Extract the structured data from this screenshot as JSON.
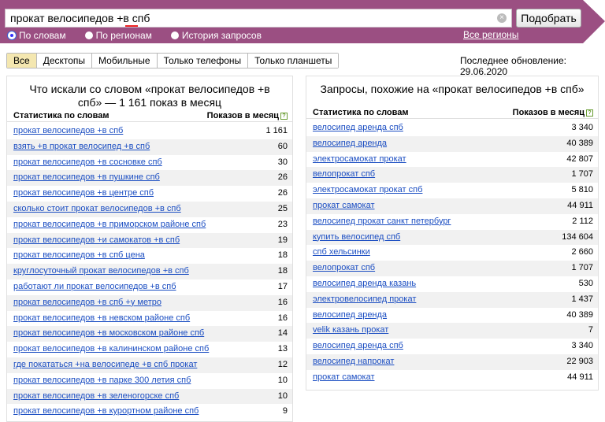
{
  "search": {
    "query": "прокат велосипедов +в спб",
    "submit_label": "Подобрать",
    "clear_glyph": "×"
  },
  "modes": [
    {
      "label": "По словам",
      "checked": true
    },
    {
      "label": "По регионам",
      "checked": false
    },
    {
      "label": "История запросов",
      "checked": false
    }
  ],
  "regions_link": "Все регионы",
  "tabs": [
    "Все",
    "Десктопы",
    "Мобильные",
    "Только телефоны",
    "Только планшеты"
  ],
  "active_tab": 0,
  "updated": "Последнее обновление: 29.06.2020",
  "colors": {
    "header": "#9b4f82",
    "link": "#1a4dc2",
    "active_tab": "#f4e7b0"
  },
  "left": {
    "title": "Что искали со словом «прокат велосипедов +в спб» — 1 161 показ в месяц",
    "col_words": "Статистика по словам",
    "col_shows": "Показов в месяц",
    "rows": [
      {
        "phrase": "прокат велосипедов +в спб",
        "count": "1 161"
      },
      {
        "phrase": "взять +в прокат велосипед +в спб",
        "count": "60"
      },
      {
        "phrase": "прокат велосипедов +в сосновке спб",
        "count": "30"
      },
      {
        "phrase": "прокат велосипедов +в пушкине спб",
        "count": "26"
      },
      {
        "phrase": "прокат велосипедов +в центре спб",
        "count": "26"
      },
      {
        "phrase": "сколько стоит прокат велосипедов +в спб",
        "count": "25"
      },
      {
        "phrase": "прокат велосипедов +в приморском районе спб",
        "count": "23"
      },
      {
        "phrase": "прокат велосипедов +и самокатов +в спб",
        "count": "19"
      },
      {
        "phrase": "прокат велосипедов +в спб цена",
        "count": "18"
      },
      {
        "phrase": "круглосуточный прокат велосипедов +в спб",
        "count": "18"
      },
      {
        "phrase": "работают ли прокат велосипедов +в спб",
        "count": "17"
      },
      {
        "phrase": "прокат велосипедов +в спб +у метро",
        "count": "16"
      },
      {
        "phrase": "прокат велосипедов +в невском районе спб",
        "count": "16"
      },
      {
        "phrase": "прокат велосипедов +в московском районе спб",
        "count": "14"
      },
      {
        "phrase": "прокат велосипедов +в калининском районе спб",
        "count": "13"
      },
      {
        "phrase": "где покататься +на велосипеде +в спб прокат",
        "count": "12"
      },
      {
        "phrase": "прокат велосипедов +в парке 300 летия спб",
        "count": "10"
      },
      {
        "phrase": "прокат велосипедов +в зеленогорске спб",
        "count": "10"
      },
      {
        "phrase": "прокат велосипедов +в курортном районе спб",
        "count": "9"
      }
    ]
  },
  "right": {
    "title": "Запросы, похожие на «прокат велосипедов +в спб»",
    "col_words": "Статистика по словам",
    "col_shows": "Показов в месяц",
    "rows": [
      {
        "phrase": "велосипед аренда спб",
        "count": "3 340"
      },
      {
        "phrase": "велосипед аренда",
        "count": "40 389"
      },
      {
        "phrase": "электросамокат прокат",
        "count": "42 807"
      },
      {
        "phrase": "велопрокат спб",
        "count": "1 707"
      },
      {
        "phrase": "электросамокат прокат спб",
        "count": "5 810"
      },
      {
        "phrase": "прокат самокат",
        "count": "44 911"
      },
      {
        "phrase": "велосипед прокат санкт петербург",
        "count": "2 112"
      },
      {
        "phrase": "купить велосипед спб",
        "count": "134 604"
      },
      {
        "phrase": "спб хельсинки",
        "count": "2 660"
      },
      {
        "phrase": "велопрокат спб",
        "count": "1 707"
      },
      {
        "phrase": "велосипед аренда казань",
        "count": "530"
      },
      {
        "phrase": "электровелосипед прокат",
        "count": "1 437"
      },
      {
        "phrase": "велосипед аренда",
        "count": "40 389"
      },
      {
        "phrase": "velik казань прокат",
        "count": "7"
      },
      {
        "phrase": "велосипед аренда спб",
        "count": "3 340"
      },
      {
        "phrase": "велосипед напрокат",
        "count": "22 903"
      },
      {
        "phrase": "прокат самокат",
        "count": "44 911"
      }
    ]
  }
}
